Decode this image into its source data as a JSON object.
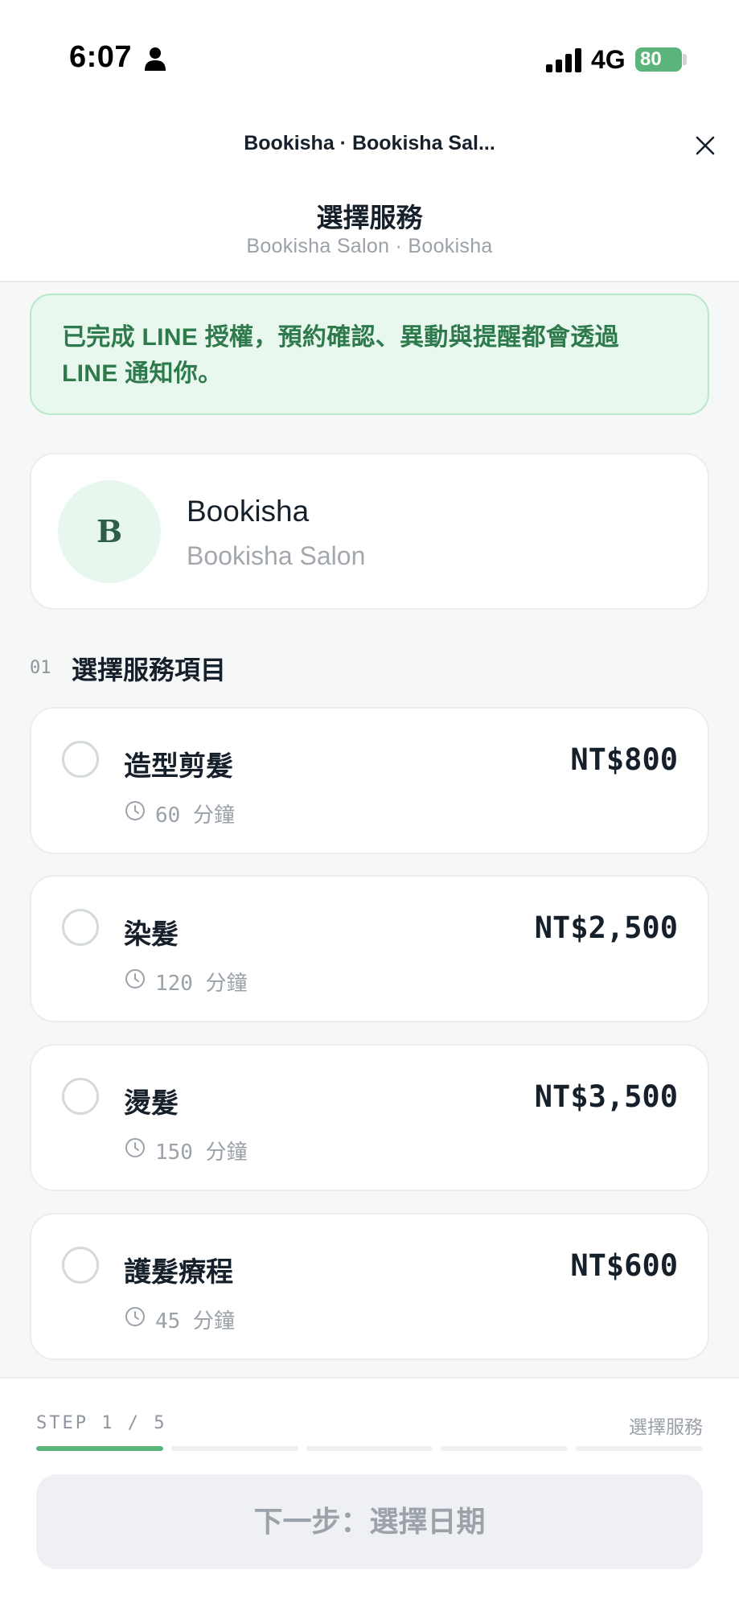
{
  "status_bar": {
    "time": "6:07",
    "network": "4G",
    "battery": "80",
    "icons": [
      "person-icon",
      "signal-icon",
      "battery-icon"
    ]
  },
  "header": {
    "nav_title": "Bookisha · Bookisha Sal...",
    "close_icon": "close-icon",
    "page_title": "選擇服務",
    "page_subtitle": "Bookisha Salon · Bookisha"
  },
  "notice": {
    "text": "已完成 LINE 授權，預約確認、異動與提醒都會透過 LINE 通知你。"
  },
  "shop": {
    "avatar_letter": "B",
    "name": "Bookisha",
    "branch": "Bookisha Salon"
  },
  "section": {
    "number": "01",
    "title": "選擇服務項目"
  },
  "services": [
    {
      "name": "造型剪髮",
      "price": "NT$800",
      "duration": "60",
      "unit": "分鐘"
    },
    {
      "name": "染髮",
      "price": "NT$2,500",
      "duration": "120",
      "unit": "分鐘"
    },
    {
      "name": "燙髮",
      "price": "NT$3,500",
      "duration": "150",
      "unit": "分鐘"
    },
    {
      "name": "護髮療程",
      "price": "NT$600",
      "duration": "45",
      "unit": "分鐘"
    }
  ],
  "footer": {
    "step_label": "STEP 1 / 5",
    "step_name": "選擇服務",
    "current_step": 1,
    "total_steps": 5,
    "next_button": "下一步：選擇日期"
  },
  "colors": {
    "accent": "#5bb57a",
    "notice_bg": "#e9f8ee",
    "notice_text": "#2e7a4c",
    "text_primary": "#16202b",
    "text_muted": "#9aa1a8"
  }
}
